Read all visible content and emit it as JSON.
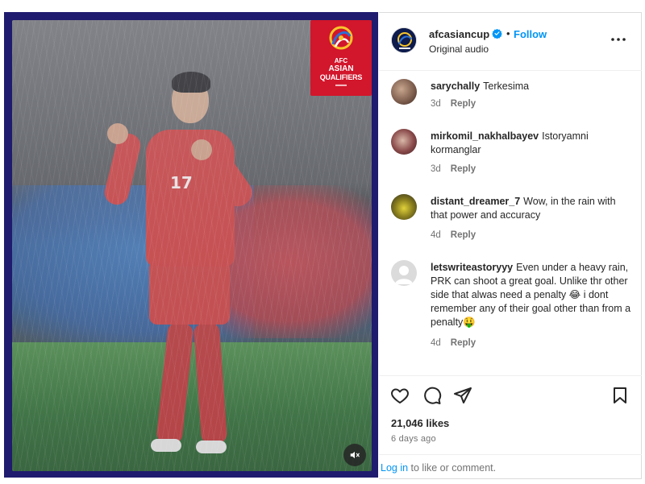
{
  "media": {
    "badge": {
      "line1": "AFC",
      "line2": "ASIAN",
      "line3": "QUALIFIERS"
    },
    "player_number": "17",
    "mute_icon": "speaker-muted-icon"
  },
  "header": {
    "username": "afcasiancup",
    "separator": "•",
    "follow_label": "Follow",
    "subtitle": "Original audio"
  },
  "comments": [
    {
      "user": "sarychally",
      "text": "Terkesima",
      "age": "3d",
      "reply": "Reply"
    },
    {
      "user": "mirkomil_nakhalbayev",
      "text": "Istoryamni kormanglar",
      "age": "3d",
      "reply": "Reply"
    },
    {
      "user": "distant_dreamer_7",
      "text": "Wow, in the rain with that power and accuracy",
      "age": "4d",
      "reply": "Reply"
    },
    {
      "user": "letswriteastoryyy",
      "text": "Even under a heavy rain, PRK can shoot a great goal. Unlike thr other side that alwas need a penalty 😂 i dont remember any of their goal other than from a penalty🤑",
      "age": "4d",
      "reply": "Reply"
    }
  ],
  "post": {
    "likes": "21,046 likes",
    "posted": "6 days ago"
  },
  "footer": {
    "login_label": "Log in",
    "rest": " to like or comment."
  },
  "colors": {
    "accent": "#0095f6",
    "badge_red": "#d2162b",
    "media_frame": "#1f1b6e"
  }
}
